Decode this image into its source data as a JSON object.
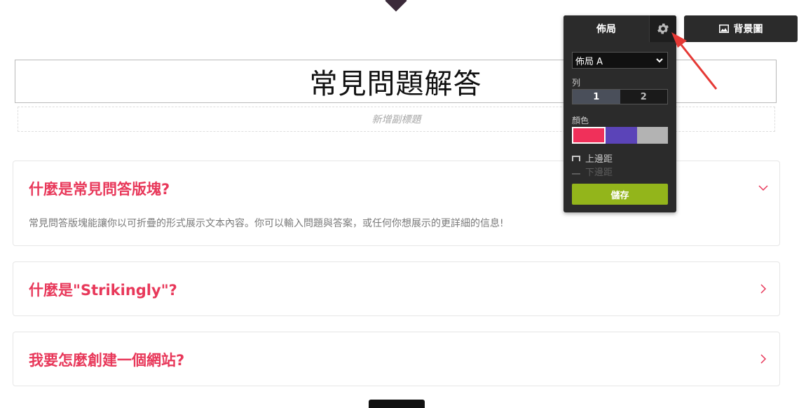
{
  "header": {
    "title": "常見問題解答",
    "subtitle_placeholder": "新增副標題"
  },
  "faq": [
    {
      "question": "什麼是常見問答版塊?",
      "answer": "常見問答版塊能讓你以可折疊的形式展示文本內容。你可以輸入問題與答案，或任何你想展示的更詳細的信息!",
      "expanded": true
    },
    {
      "question": "什麼是\"Strikingly\"?",
      "answer": "",
      "expanded": false
    },
    {
      "question": "我要怎麼創建一個網站?",
      "answer": "",
      "expanded": false
    }
  ],
  "layout_panel": {
    "tab_label": "佈局",
    "layout_select": "佈局 A",
    "columns_label": "列",
    "columns_options": [
      "1",
      "2"
    ],
    "columns_selected": "1",
    "color_label": "顏色",
    "colors": [
      "#f0305a",
      "#5b44b8",
      "#b3b3b3"
    ],
    "top_margin_label": "上邊距",
    "bottom_margin_label": "下邊距",
    "save_label": "儲存"
  },
  "toolbar": {
    "background_image_label": "背景圖"
  },
  "icons": {
    "settings": "gear-icon",
    "background": "image-icon",
    "chevron_down": "chevron-down-icon",
    "chevron_right": "chevron-right-icon"
  },
  "colors": {
    "accent": "#e8385a",
    "save_green": "#93b51b",
    "panel_bg": "#2b2b2b",
    "annotation_red": "#e53935"
  }
}
